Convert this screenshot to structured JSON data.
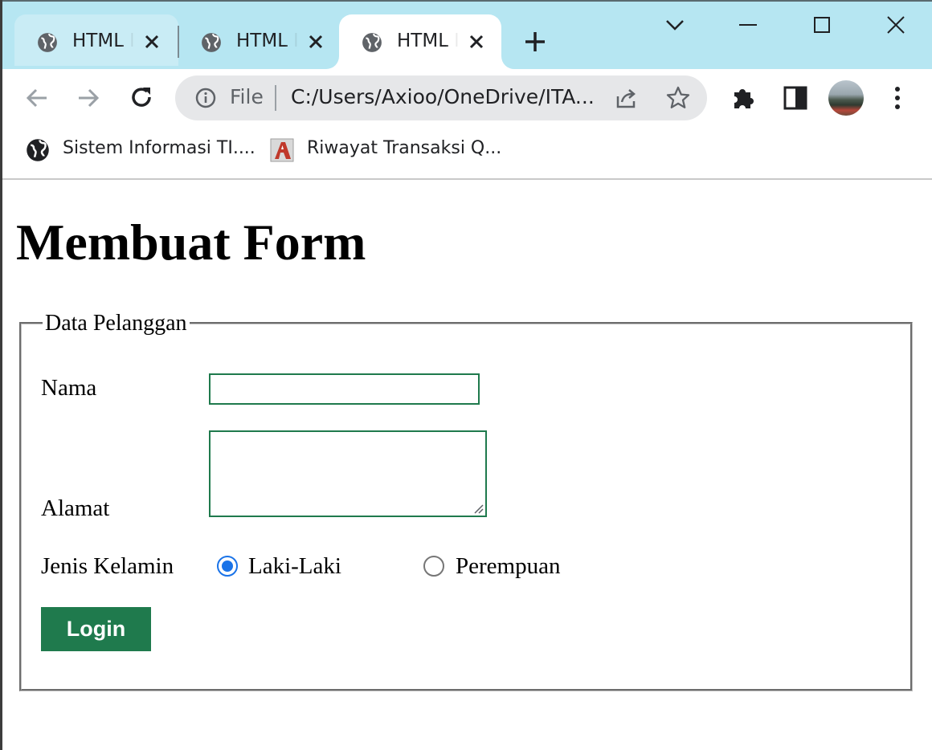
{
  "browser": {
    "tabs": [
      {
        "title": "HTML Latihan",
        "active": false
      },
      {
        "title": "HTML Latihan",
        "active": false
      },
      {
        "title": "HTML Latihan",
        "active": true
      }
    ],
    "omnibox": {
      "scheme_chip": "File",
      "url": "C:/Users/Axioo/OneDrive/ITA..."
    },
    "bookmarks": [
      {
        "label": "Sistem Informasi TI....",
        "icon": "globe-icon"
      },
      {
        "label": "Riwayat Transaksi Q...",
        "icon": "site-logo-icon"
      }
    ],
    "colors": {
      "tabstrip": "#b6e6f2",
      "omnibox": "#e6e7e9"
    }
  },
  "page": {
    "heading": "Membuat Form",
    "form": {
      "legend": "Data Pelanggan",
      "nama_label": "Nama",
      "nama_value": "",
      "alamat_label": "Alamat",
      "alamat_value": "",
      "gender_label": "Jenis Kelamin",
      "gender_options": [
        {
          "label": "Laki-Laki",
          "checked": true
        },
        {
          "label": "Perempuan",
          "checked": false
        }
      ],
      "submit_label": "Login"
    },
    "colors": {
      "button": "#1f7a4d",
      "input_border": "#1f7a4d",
      "radio_checked": "#1a73e8"
    }
  }
}
